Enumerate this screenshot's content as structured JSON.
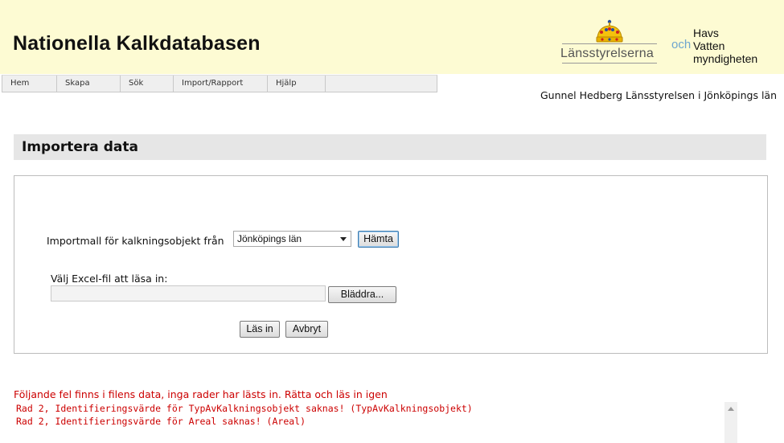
{
  "header": {
    "title": "Nationella Kalkdatabasen",
    "lansstyrelsen_logo": "Länsstyrelserna",
    "och": "och",
    "hav_logo": [
      "Havs",
      "Vatten",
      "myndigheten"
    ]
  },
  "nav": {
    "items": [
      {
        "label": "Hem"
      },
      {
        "label": "Skapa"
      },
      {
        "label": "Sök"
      },
      {
        "label": "Import/Rapport"
      },
      {
        "label": "Hjälp"
      },
      {
        "label": ""
      }
    ]
  },
  "user": {
    "name": "Gunnel Hedberg Länsstyrelsen i Jönköpings län"
  },
  "section": {
    "title": "Importera data"
  },
  "form": {
    "template_label": "Importmall för kalkningsobjekt från",
    "template_select_value": "Jönköpings län",
    "fetch_button": "Hämta",
    "file_label": "Välj Excel-fil att läsa in:",
    "file_value": "",
    "browse_button": "Bläddra...",
    "read_button": "Läs in",
    "cancel_button": "Avbryt"
  },
  "errors": {
    "message": "Följande fel finns i filens data, inga rader har lästs in. Rätta och läs in igen",
    "lines": [
      "Rad 2, Identifieringsvärde för TypAvKalkningsobjekt saknas! (TypAvKalkningsobjekt)",
      "Rad 2, Identifieringsvärde för Areal saknas! (Areal)"
    ]
  },
  "colors": {
    "header_bg": "#fdfbd3",
    "error_text": "#cc0000",
    "section_bg": "#e6e6e6",
    "och_blue": "#6fa6cf"
  },
  "icons": [
    "crown-icon",
    "dropdown-arrow-icon",
    "scroll-up-icon"
  ]
}
